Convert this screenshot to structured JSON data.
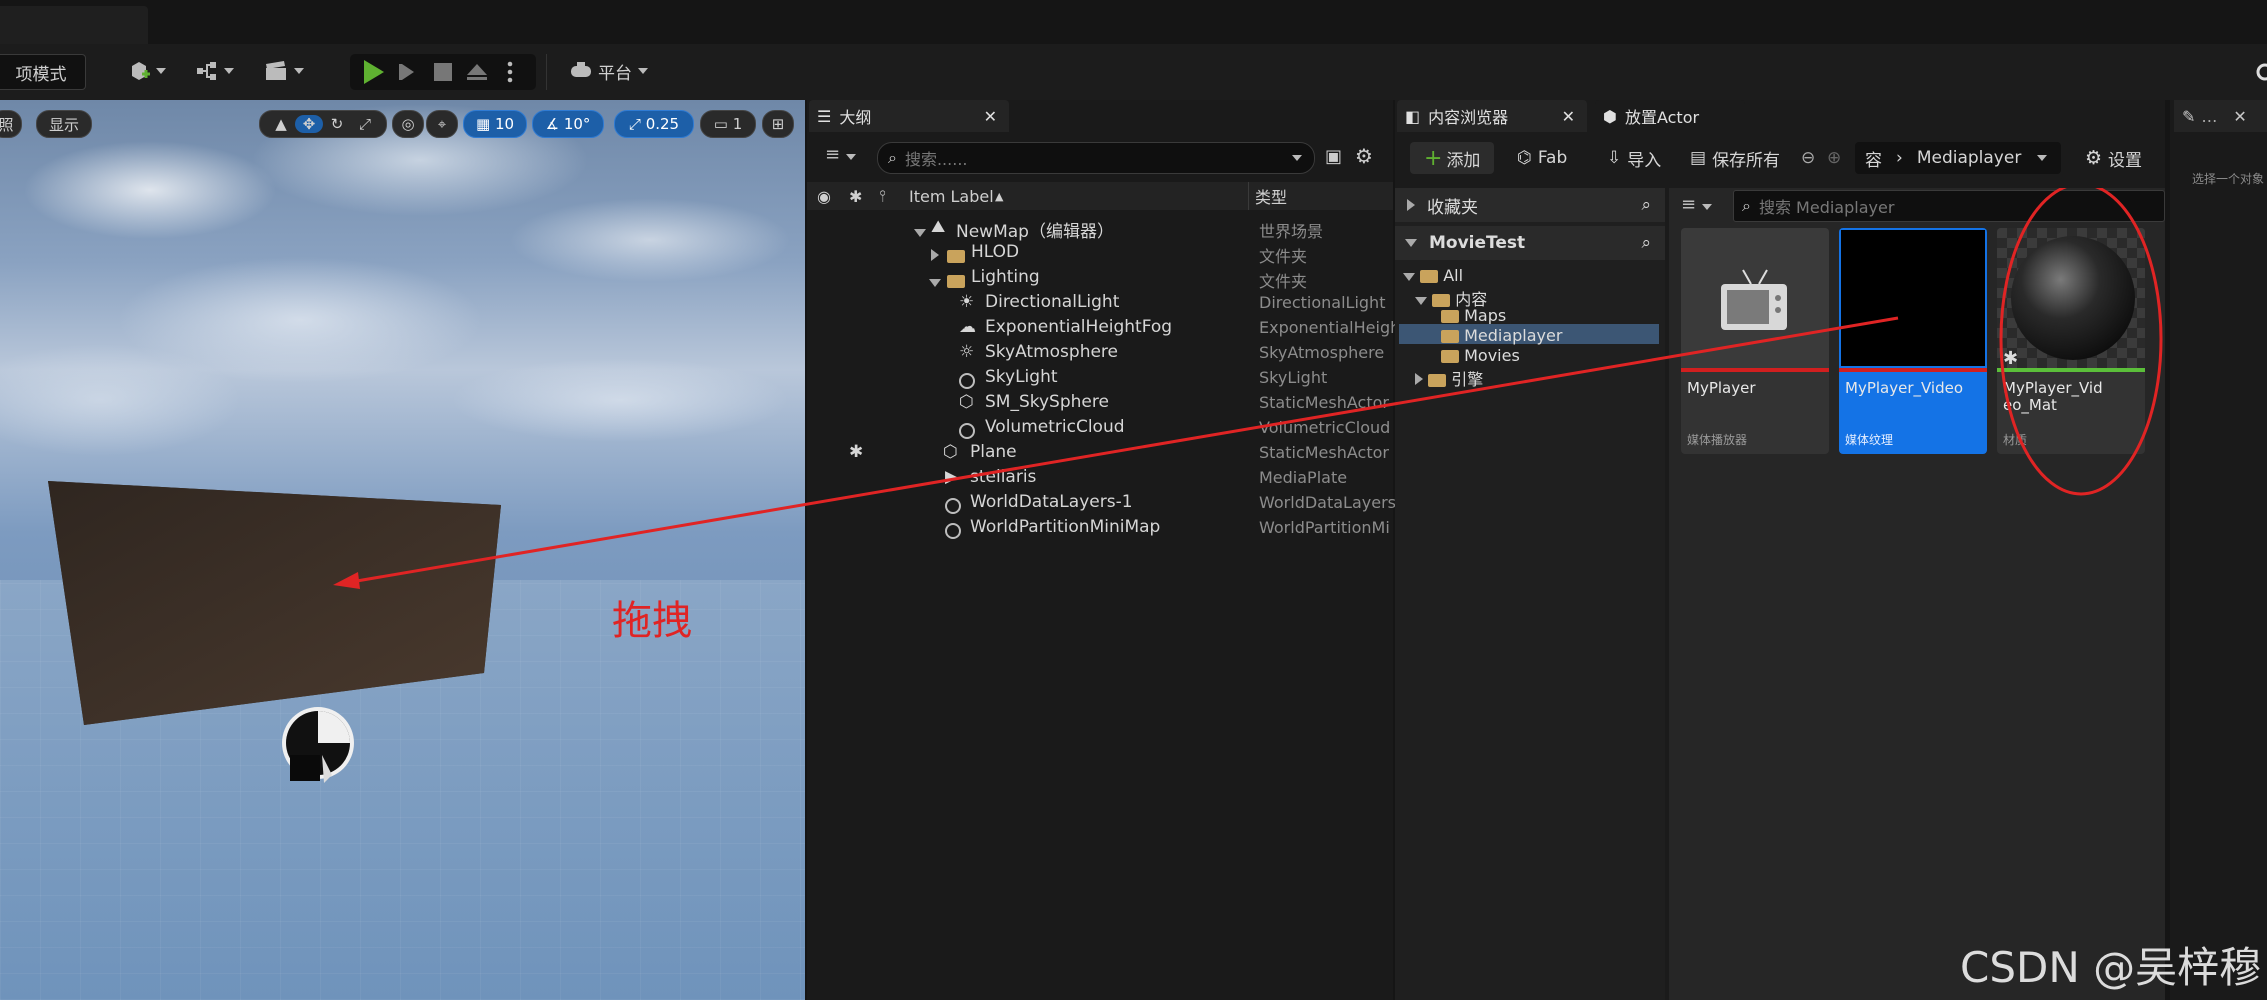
{
  "toolbar": {
    "mode_label": "项模式",
    "platform_label": "平台"
  },
  "viewport": {
    "btn_lit": "照",
    "btn_show": "显示",
    "grid_value": "10",
    "angle_value": "10°",
    "scale_value": "0.25",
    "camera_value": "1",
    "drag_annotation": "拖拽"
  },
  "outliner": {
    "tab_title": "大纲",
    "search_placeholder": "搜索......",
    "col_label": "Item Label",
    "col_type": "类型",
    "rows": [
      {
        "label": "NewMap（编辑器）",
        "type": "世界场景"
      },
      {
        "label": "HLOD",
        "type": "文件夹"
      },
      {
        "label": "Lighting",
        "type": "文件夹"
      },
      {
        "label": "DirectionalLight",
        "type": "DirectionalLight"
      },
      {
        "label": "ExponentialHeightFog",
        "type": "ExponentialHeigh"
      },
      {
        "label": "SkyAtmosphere",
        "type": "SkyAtmosphere"
      },
      {
        "label": "SkyLight",
        "type": "SkyLight"
      },
      {
        "label": "SM_SkySphere",
        "type": "StaticMeshActor"
      },
      {
        "label": "VolumetricCloud",
        "type": "VolumetricCloud"
      },
      {
        "label": "Plane",
        "type": "StaticMeshActor"
      },
      {
        "label": "stellaris",
        "type": "MediaPlate"
      },
      {
        "label": "WorldDataLayers-1",
        "type": "WorldDataLayers"
      },
      {
        "label": "WorldPartitionMiniMap",
        "type": "WorldPartitionMi"
      }
    ]
  },
  "content_browser": {
    "tab_title": "内容浏览器",
    "tab_place": "放置Actor",
    "add_label": "添加",
    "fab_label": "Fab",
    "import_label": "导入",
    "save_all_label": "保存所有",
    "breadcrumb_prev": "容",
    "breadcrumb_current": "Mediaplayer",
    "settings_label": "设置",
    "favorites_label": "收藏夹",
    "project_label": "MovieTest",
    "search_placeholder": "搜索 Mediaplayer",
    "tree": [
      "All",
      "内容",
      "Maps",
      "Mediaplayer",
      "Movies",
      "引擎"
    ],
    "assets": [
      {
        "name": "MyPlayer",
        "kind": "媒体播放器",
        "bar_color": "#d11f1f"
      },
      {
        "name": "MyPlayer_Video",
        "kind": "媒体纹理",
        "bar_color": "#d11f1f"
      },
      {
        "name": "MyPlayer_Video_Mat",
        "kind": "材质",
        "bar_color": "#5bbf3a"
      }
    ]
  },
  "details": {
    "hint": "选择一个对象"
  },
  "watermark": "CSDN @吴梓穆",
  "colors": {
    "accent": "#1473e6",
    "annotation": "#e02424",
    "play": "#5fb131"
  }
}
